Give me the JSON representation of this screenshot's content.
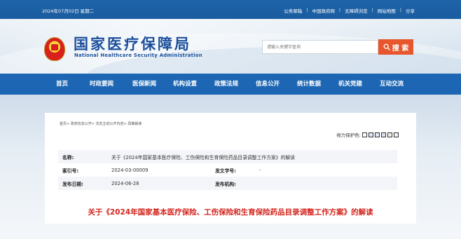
{
  "topbar": {
    "date": "2024年07月02日 星期二",
    "links": [
      "公务邮箱",
      "中国政府网",
      "无障碍浏览",
      "网站地图",
      "分享"
    ],
    "separator": "|"
  },
  "header": {
    "title": "国家医疗保障局",
    "subtitle": "National Healthcare Security Administration",
    "search_placeholder": "请输入关键字查询",
    "search_button_label": "搜 索"
  },
  "nav": {
    "items": [
      "首页",
      "时政要闻",
      "医保新闻",
      "机构设置",
      "政策法规",
      "信息公开",
      "统计数据",
      "机关党建",
      "互动交流"
    ]
  },
  "breadcrumb": "首页> 政府信息公开> 法定主动公开内容> 政策解读",
  "vision": {
    "label": "视力保护色:",
    "swatches": [
      "#ffffff",
      "#dbe8f6",
      "#e6e6fa",
      "#d9e3ee",
      "#eef1e8",
      "#f5f5f5"
    ]
  },
  "meta": {
    "name_label": "名称:",
    "name_value": "关于《2024年国家基本医疗保险、工伤保险和生育保险药品目录调整工作方案》的解读",
    "index_label": "索引号:",
    "index_value": "2024-03-00009",
    "doc_no_label": "发文字号:",
    "doc_no_value": "-",
    "date_label": "发布日期:",
    "date_value": "2024-06-28",
    "org_label": "发布机构:",
    "org_value": ""
  },
  "article": {
    "title": "关于《2024年国家基本医疗保险、工伤保险和生育保险药品目录调整工作方案》的解读"
  },
  "colors": {
    "topbar": "#1e63a9",
    "nav": "#1d66b3",
    "brand_blue": "#1b4f9c",
    "search_button": "#e7562c",
    "article_title": "#d3251d"
  }
}
